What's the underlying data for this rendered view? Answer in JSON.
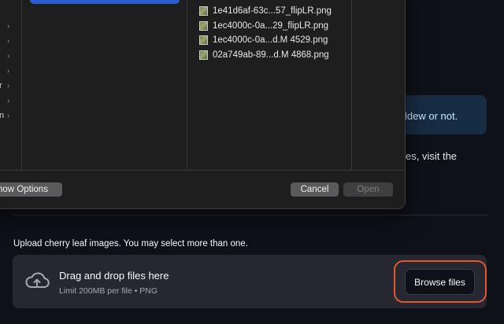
{
  "dialog": {
    "files": [
      {
        "name": "1e41d6af-63c...57_flipLR.png"
      },
      {
        "name": "1ec4000c-0a...29_flipLR.png"
      },
      {
        "name": "1ec4000c-0a...d.M 4529.png"
      },
      {
        "name": "02a749ab-89...d.M 4868.png"
      }
    ],
    "sidebar_fragments": [
      "r",
      "n"
    ],
    "show_options_label": "how Options",
    "cancel_label": "Cancel",
    "open_label": "Open"
  },
  "page": {
    "info_text": "ldew or not.",
    "body_text": "es, visit the",
    "upload_label": "Upload cherry leaf images. You may select more than one.",
    "dropzone_title": "Drag and drop files here",
    "dropzone_subtitle": "Limit 200MB per file • PNG",
    "browse_label": "Browse files"
  },
  "colors": {
    "background": "#0e1117",
    "dropzone": "#262730",
    "info_box": "#172d43",
    "highlight": "#e4572e",
    "selection": "#2c5dcf"
  },
  "icons": [
    "cloud-upload-icon",
    "chevron-right-icon",
    "image-file-icon"
  ]
}
